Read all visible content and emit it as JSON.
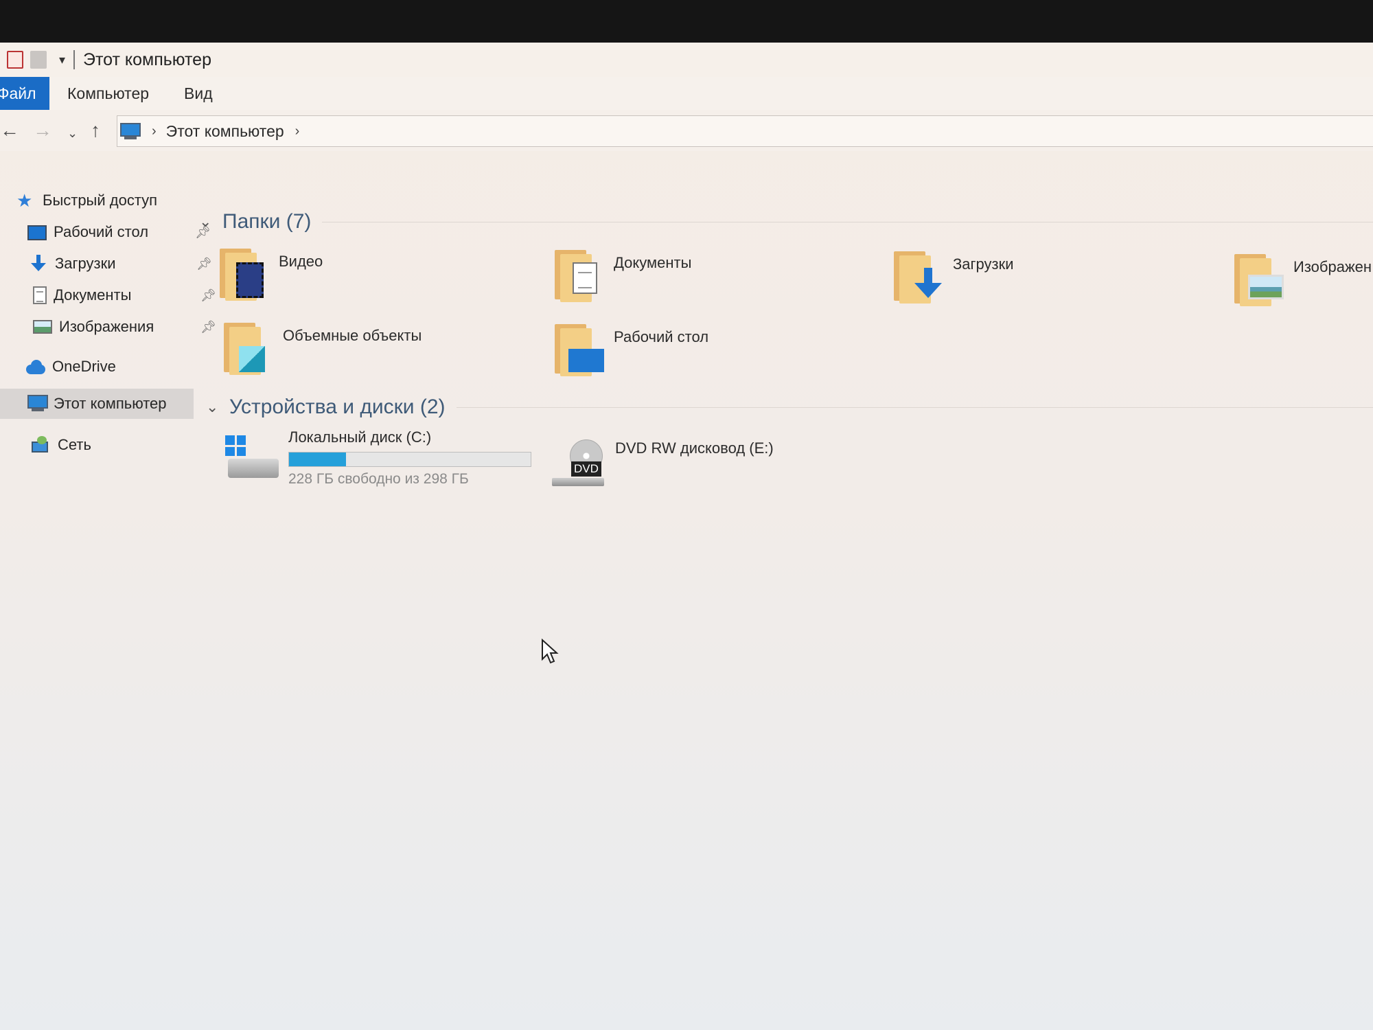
{
  "window": {
    "title": "Этот компьютер"
  },
  "ribbon": {
    "tabs": [
      "Файл",
      "Компьютер",
      "Вид"
    ]
  },
  "addressbar": {
    "location": "Этот компьютер"
  },
  "navpane": {
    "items": [
      {
        "label": "Быстрый доступ",
        "icon": "star-icon",
        "pinned": false
      },
      {
        "label": "Рабочий стол",
        "icon": "desktop-icon",
        "pinned": true
      },
      {
        "label": "Загрузки",
        "icon": "download-icon",
        "pinned": true
      },
      {
        "label": "Документы",
        "icon": "document-icon",
        "pinned": true
      },
      {
        "label": "Изображения",
        "icon": "image-icon",
        "pinned": true
      },
      {
        "label": "OneDrive",
        "icon": "cloud-icon",
        "pinned": false
      },
      {
        "label": "Этот компьютер",
        "icon": "computer-icon",
        "pinned": false,
        "selected": true
      },
      {
        "label": "Сеть",
        "icon": "network-icon",
        "pinned": false
      }
    ]
  },
  "folders": {
    "header": "Папки (7)",
    "items": [
      {
        "label": "Видео",
        "icon": "video-folder-icon"
      },
      {
        "label": "Документы",
        "icon": "documents-folder-icon"
      },
      {
        "label": "Загрузки",
        "icon": "downloads-folder-icon"
      },
      {
        "label": "Изображен",
        "icon": "pictures-folder-icon"
      },
      {
        "label": "Объемные объекты",
        "icon": "3d-objects-folder-icon"
      },
      {
        "label": "Рабочий стол",
        "icon": "desktop-folder-icon"
      }
    ]
  },
  "devices": {
    "header": "Устройства и диски (2)",
    "items": [
      {
        "label": "Локальный диск (C:)",
        "free_text": "228 ГБ свободно из 298 ГБ",
        "used_fraction": 0.235,
        "icon": "local-disk-icon"
      },
      {
        "label": "DVD RW дисковод (E:)",
        "badge": "DVD",
        "icon": "dvd-drive-icon"
      }
    ]
  },
  "colors": {
    "ribbon_file_tab": "#1a6cc6",
    "accent": "#25a0da",
    "group_header": "#3e5a78"
  }
}
